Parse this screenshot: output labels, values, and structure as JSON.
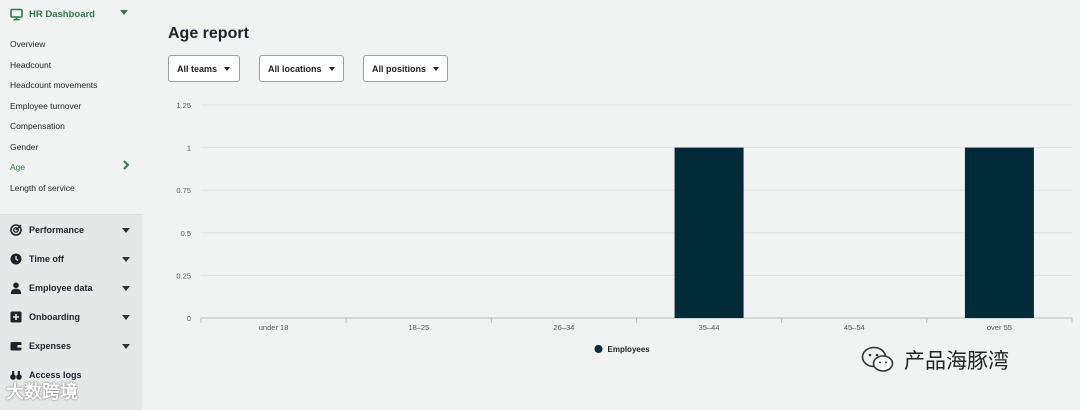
{
  "sidebar": {
    "header": {
      "label": "HR Dashboard",
      "icon": "monitor-icon"
    },
    "items": [
      {
        "label": "Overview",
        "active": false
      },
      {
        "label": "Headcount",
        "active": false
      },
      {
        "label": "Headcount movements",
        "active": false
      },
      {
        "label": "Employee turnover",
        "active": false
      },
      {
        "label": "Compensation",
        "active": false
      },
      {
        "label": "Gender",
        "active": false
      },
      {
        "label": "Age",
        "active": true
      },
      {
        "label": "Length of service",
        "active": false
      }
    ],
    "groups": [
      {
        "label": "Performance",
        "icon": "target-icon"
      },
      {
        "label": "Time off",
        "icon": "clock-icon"
      },
      {
        "label": "Employee data",
        "icon": "person-icon"
      },
      {
        "label": "Onboarding",
        "icon": "plus-square-icon"
      },
      {
        "label": "Expenses",
        "icon": "wallet-icon"
      },
      {
        "label": "Access logs",
        "icon": "binoculars-icon"
      }
    ]
  },
  "main": {
    "title": "Age report",
    "filters": [
      {
        "label": "All teams"
      },
      {
        "label": "All locations"
      },
      {
        "label": "All positions"
      }
    ]
  },
  "chart_data": {
    "type": "bar",
    "categories": [
      "under 18",
      "18–25",
      "26–34",
      "35–44",
      "45–54",
      "over 55"
    ],
    "series": [
      {
        "name": "Employees",
        "values": [
          0,
          0,
          0,
          1,
          0,
          1
        ],
        "color": "#022b3a"
      }
    ],
    "yticks": [
      "0",
      "0.25",
      "0.5",
      "0.75",
      "1",
      "1.25"
    ],
    "ylim": [
      0,
      1.25
    ],
    "grid": true,
    "legend": "bottom-center"
  },
  "watermarks": {
    "left": "大数跨境",
    "right": "产品海豚湾"
  },
  "colors": {
    "accent": "#2b7a4b",
    "bar": "#022b3a"
  }
}
